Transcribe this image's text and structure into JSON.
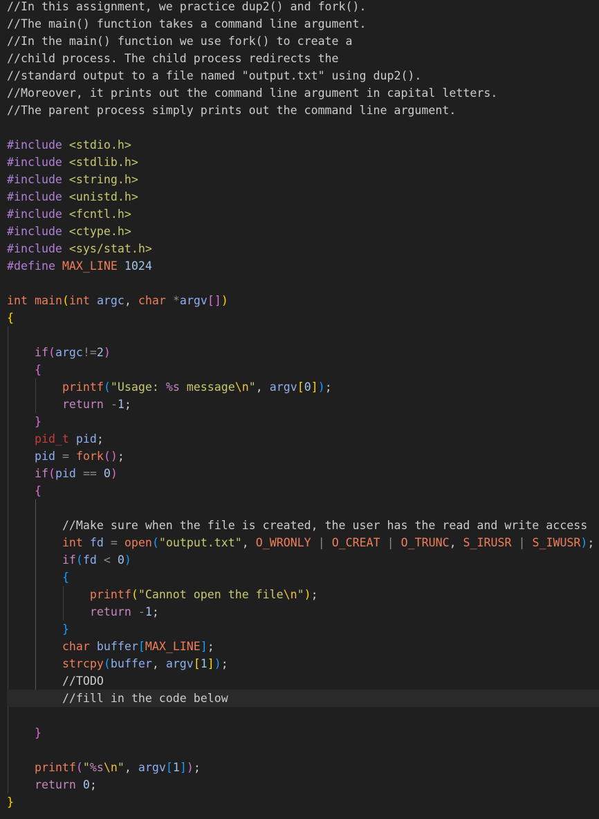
{
  "editor": {
    "language": "c",
    "theme_colors": {
      "background": "#1f1f1f",
      "current_line": "#2a2a2a",
      "comment": "#cccccc",
      "keyword": "#c586c0",
      "type": "#f07e5b",
      "function": "#f07e5b",
      "variable": "#8faff0",
      "string": "#c8c870",
      "number": "#a4c5e9",
      "bracket_1": "#ffd700",
      "bracket_2": "#da70d6",
      "bracket_3": "#179fff"
    },
    "current_line_index": 40,
    "lines": [
      [
        {
          "t": "//In this assignment, we practice dup2() and fork().",
          "c": "comment"
        }
      ],
      [
        {
          "t": "//The main() function takes a command line argument.",
          "c": "comment"
        }
      ],
      [
        {
          "t": "//In the main() function we use fork() to create a",
          "c": "comment"
        }
      ],
      [
        {
          "t": "//child process. The child process redirects the",
          "c": "comment"
        }
      ],
      [
        {
          "t": "//standard output to a file named \"output.txt\" using dup2().",
          "c": "comment"
        }
      ],
      [
        {
          "t": "//Moreover, it prints out the command line argument in capital letters.",
          "c": "comment"
        }
      ],
      [
        {
          "t": "//The parent process simply prints out the command line argument.",
          "c": "comment"
        }
      ],
      [],
      [
        {
          "t": "#include ",
          "c": "kwpre"
        },
        {
          "t": "<stdio.h>",
          "c": "string"
        }
      ],
      [
        {
          "t": "#include ",
          "c": "kwpre"
        },
        {
          "t": "<stdlib.h>",
          "c": "string"
        }
      ],
      [
        {
          "t": "#include ",
          "c": "kwpre"
        },
        {
          "t": "<string.h>",
          "c": "string"
        }
      ],
      [
        {
          "t": "#include ",
          "c": "kwpre"
        },
        {
          "t": "<unistd.h>",
          "c": "string"
        }
      ],
      [
        {
          "t": "#include ",
          "c": "kwpre"
        },
        {
          "t": "<fcntl.h>",
          "c": "string"
        }
      ],
      [
        {
          "t": "#include ",
          "c": "kwpre"
        },
        {
          "t": "<ctype.h>",
          "c": "string"
        }
      ],
      [
        {
          "t": "#include ",
          "c": "kwpre"
        },
        {
          "t": "<sys/stat.h>",
          "c": "string"
        }
      ],
      [
        {
          "t": "#define ",
          "c": "kwpre"
        },
        {
          "t": "MAX_LINE",
          "c": "macro"
        },
        {
          "t": " ",
          "c": "punct"
        },
        {
          "t": "1024",
          "c": "number"
        }
      ],
      [],
      [
        {
          "t": "int",
          "c": "type"
        },
        {
          "t": " ",
          "c": "punct"
        },
        {
          "t": "main",
          "c": "func"
        },
        {
          "t": "(",
          "c": "b1"
        },
        {
          "t": "int",
          "c": "type"
        },
        {
          "t": " ",
          "c": "punct"
        },
        {
          "t": "argc",
          "c": "var"
        },
        {
          "t": ", ",
          "c": "punct"
        },
        {
          "t": "char",
          "c": "type"
        },
        {
          "t": " ",
          "c": "punct"
        },
        {
          "t": "*",
          "c": "op"
        },
        {
          "t": "argv",
          "c": "var"
        },
        {
          "t": "[]",
          "c": "b2"
        },
        {
          "t": ")",
          "c": "b1"
        }
      ],
      [
        {
          "t": "{",
          "c": "b1"
        }
      ],
      [],
      [
        {
          "t": "    ",
          "c": "punct"
        },
        {
          "t": "if",
          "c": "flow"
        },
        {
          "t": "(",
          "c": "b2"
        },
        {
          "t": "argc",
          "c": "var"
        },
        {
          "t": "!=",
          "c": "op"
        },
        {
          "t": "2",
          "c": "number"
        },
        {
          "t": ")",
          "c": "b2"
        }
      ],
      [
        {
          "t": "    ",
          "c": "punct"
        },
        {
          "t": "{",
          "c": "b2"
        }
      ],
      [
        {
          "t": "        ",
          "c": "punct"
        },
        {
          "t": "printf",
          "c": "func"
        },
        {
          "t": "(",
          "c": "b3"
        },
        {
          "t": "\"Usage: ",
          "c": "string"
        },
        {
          "t": "%s",
          "c": "format"
        },
        {
          "t": " message",
          "c": "string"
        },
        {
          "t": "\\n",
          "c": "escape"
        },
        {
          "t": "\"",
          "c": "string"
        },
        {
          "t": ", ",
          "c": "punct"
        },
        {
          "t": "argv",
          "c": "var"
        },
        {
          "t": "[",
          "c": "b1"
        },
        {
          "t": "0",
          "c": "number"
        },
        {
          "t": "]",
          "c": "b1"
        },
        {
          "t": ")",
          "c": "b3"
        },
        {
          "t": ";",
          "c": "punct"
        }
      ],
      [
        {
          "t": "        ",
          "c": "punct"
        },
        {
          "t": "return",
          "c": "flow"
        },
        {
          "t": " ",
          "c": "punct"
        },
        {
          "t": "-",
          "c": "op"
        },
        {
          "t": "1",
          "c": "number"
        },
        {
          "t": ";",
          "c": "punct"
        }
      ],
      [
        {
          "t": "    ",
          "c": "punct"
        },
        {
          "t": "}",
          "c": "b2"
        }
      ],
      [
        {
          "t": "    ",
          "c": "punct"
        },
        {
          "t": "pid_t",
          "c": "pidt"
        },
        {
          "t": " ",
          "c": "punct"
        },
        {
          "t": "pid",
          "c": "var"
        },
        {
          "t": ";",
          "c": "punct"
        }
      ],
      [
        {
          "t": "    ",
          "c": "punct"
        },
        {
          "t": "pid",
          "c": "var"
        },
        {
          "t": " ",
          "c": "punct"
        },
        {
          "t": "=",
          "c": "op"
        },
        {
          "t": " ",
          "c": "punct"
        },
        {
          "t": "fork",
          "c": "func"
        },
        {
          "t": "()",
          "c": "b2"
        },
        {
          "t": ";",
          "c": "punct"
        }
      ],
      [
        {
          "t": "    ",
          "c": "punct"
        },
        {
          "t": "if",
          "c": "flow"
        },
        {
          "t": "(",
          "c": "b2"
        },
        {
          "t": "pid",
          "c": "var"
        },
        {
          "t": " ",
          "c": "punct"
        },
        {
          "t": "==",
          "c": "op"
        },
        {
          "t": " ",
          "c": "punct"
        },
        {
          "t": "0",
          "c": "number"
        },
        {
          "t": ")",
          "c": "b2"
        }
      ],
      [
        {
          "t": "    ",
          "c": "punct"
        },
        {
          "t": "{",
          "c": "b2"
        }
      ],
      [],
      [
        {
          "t": "        ",
          "c": "punct"
        },
        {
          "t": "//Make sure when the file is created, the user has the read and write access",
          "c": "comment"
        }
      ],
      [
        {
          "t": "        ",
          "c": "punct"
        },
        {
          "t": "int",
          "c": "type"
        },
        {
          "t": " ",
          "c": "punct"
        },
        {
          "t": "fd",
          "c": "var"
        },
        {
          "t": " ",
          "c": "punct"
        },
        {
          "t": "=",
          "c": "op"
        },
        {
          "t": " ",
          "c": "punct"
        },
        {
          "t": "open",
          "c": "func"
        },
        {
          "t": "(",
          "c": "b3"
        },
        {
          "t": "\"output.txt\"",
          "c": "string"
        },
        {
          "t": ", ",
          "c": "punct"
        },
        {
          "t": "O_WRONLY",
          "c": "macro"
        },
        {
          "t": " ",
          "c": "punct"
        },
        {
          "t": "|",
          "c": "op"
        },
        {
          "t": " ",
          "c": "punct"
        },
        {
          "t": "O_CREAT",
          "c": "macro"
        },
        {
          "t": " ",
          "c": "punct"
        },
        {
          "t": "|",
          "c": "op"
        },
        {
          "t": " ",
          "c": "punct"
        },
        {
          "t": "O_TRUNC",
          "c": "macro"
        },
        {
          "t": ", ",
          "c": "punct"
        },
        {
          "t": "S_IRUSR",
          "c": "macro"
        },
        {
          "t": " ",
          "c": "punct"
        },
        {
          "t": "|",
          "c": "op"
        },
        {
          "t": " ",
          "c": "punct"
        },
        {
          "t": "S_IWUSR",
          "c": "macro"
        },
        {
          "t": ")",
          "c": "b3"
        },
        {
          "t": ";",
          "c": "punct"
        }
      ],
      [
        {
          "t": "        ",
          "c": "punct"
        },
        {
          "t": "if",
          "c": "flow"
        },
        {
          "t": "(",
          "c": "b3"
        },
        {
          "t": "fd",
          "c": "var"
        },
        {
          "t": " ",
          "c": "punct"
        },
        {
          "t": "<",
          "c": "op"
        },
        {
          "t": " ",
          "c": "punct"
        },
        {
          "t": "0",
          "c": "number"
        },
        {
          "t": ")",
          "c": "b3"
        }
      ],
      [
        {
          "t": "        ",
          "c": "punct"
        },
        {
          "t": "{",
          "c": "b3"
        }
      ],
      [
        {
          "t": "            ",
          "c": "punct"
        },
        {
          "t": "printf",
          "c": "func"
        },
        {
          "t": "(",
          "c": "b1"
        },
        {
          "t": "\"Cannot open the file",
          "c": "string"
        },
        {
          "t": "\\n",
          "c": "escape"
        },
        {
          "t": "\"",
          "c": "string"
        },
        {
          "t": ")",
          "c": "b1"
        },
        {
          "t": ";",
          "c": "punct"
        }
      ],
      [
        {
          "t": "            ",
          "c": "punct"
        },
        {
          "t": "return",
          "c": "flow"
        },
        {
          "t": " ",
          "c": "punct"
        },
        {
          "t": "-",
          "c": "op"
        },
        {
          "t": "1",
          "c": "number"
        },
        {
          "t": ";",
          "c": "punct"
        }
      ],
      [
        {
          "t": "        ",
          "c": "punct"
        },
        {
          "t": "}",
          "c": "b3"
        }
      ],
      [
        {
          "t": "        ",
          "c": "punct"
        },
        {
          "t": "char",
          "c": "type"
        },
        {
          "t": " ",
          "c": "punct"
        },
        {
          "t": "buffer",
          "c": "var"
        },
        {
          "t": "[",
          "c": "b3"
        },
        {
          "t": "MAX_LINE",
          "c": "macro"
        },
        {
          "t": "]",
          "c": "b3"
        },
        {
          "t": ";",
          "c": "punct"
        }
      ],
      [
        {
          "t": "        ",
          "c": "punct"
        },
        {
          "t": "strcpy",
          "c": "func"
        },
        {
          "t": "(",
          "c": "b3"
        },
        {
          "t": "buffer",
          "c": "var"
        },
        {
          "t": ", ",
          "c": "punct"
        },
        {
          "t": "argv",
          "c": "var"
        },
        {
          "t": "[",
          "c": "b1"
        },
        {
          "t": "1",
          "c": "number"
        },
        {
          "t": "]",
          "c": "b1"
        },
        {
          "t": ")",
          "c": "b3"
        },
        {
          "t": ";",
          "c": "punct"
        }
      ],
      [
        {
          "t": "        ",
          "c": "punct"
        },
        {
          "t": "//TODO",
          "c": "comment"
        }
      ],
      [
        {
          "t": "        ",
          "c": "punct"
        },
        {
          "t": "//fill in the code below",
          "c": "comment"
        }
      ],
      [],
      [
        {
          "t": "    ",
          "c": "punct"
        },
        {
          "t": "}",
          "c": "b2"
        }
      ],
      [],
      [
        {
          "t": "    ",
          "c": "punct"
        },
        {
          "t": "printf",
          "c": "func"
        },
        {
          "t": "(",
          "c": "b2"
        },
        {
          "t": "\"",
          "c": "string"
        },
        {
          "t": "%s",
          "c": "format"
        },
        {
          "t": "\\n",
          "c": "escape"
        },
        {
          "t": "\"",
          "c": "string"
        },
        {
          "t": ", ",
          "c": "punct"
        },
        {
          "t": "argv",
          "c": "var"
        },
        {
          "t": "[",
          "c": "b3"
        },
        {
          "t": "1",
          "c": "number"
        },
        {
          "t": "]",
          "c": "b3"
        },
        {
          "t": ")",
          "c": "b2"
        },
        {
          "t": ";",
          "c": "punct"
        }
      ],
      [
        {
          "t": "    ",
          "c": "punct"
        },
        {
          "t": "return",
          "c": "flow"
        },
        {
          "t": " ",
          "c": "punct"
        },
        {
          "t": "0",
          "c": "number"
        },
        {
          "t": ";",
          "c": "punct"
        }
      ],
      [
        {
          "t": "}",
          "c": "b1"
        }
      ]
    ]
  }
}
